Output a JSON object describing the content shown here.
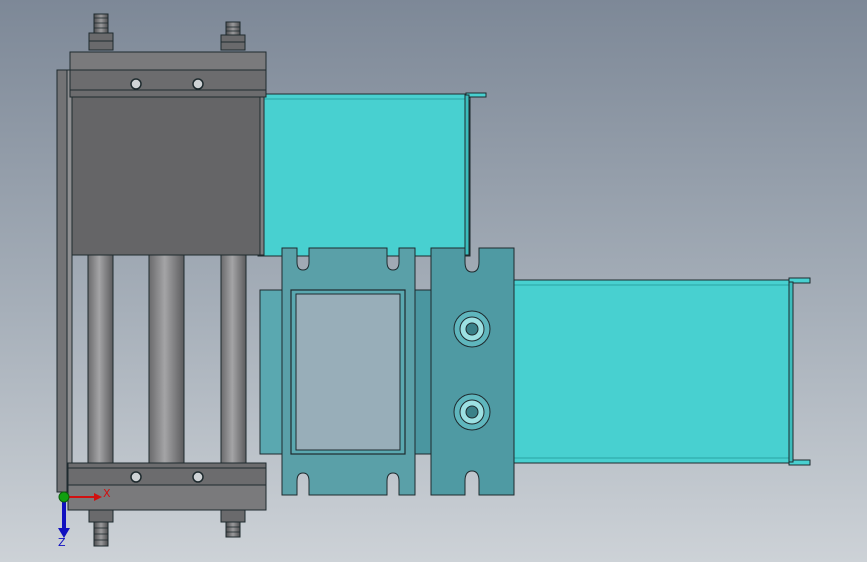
{
  "viewport": {
    "background_top": "#7d8897",
    "background_bottom": "#cdd2d7"
  },
  "colors": {
    "steel_dark": "#5f5f61",
    "steel_mid": "#737375",
    "steel_light": "#8e8e90",
    "rod": "#8a8a8c",
    "cyan_body": "#48d0d0",
    "cyan_edge": "#2aa4a4",
    "teal_plate": "#5aa8b0",
    "teal_plate_dark": "#4a96a0",
    "outline": "#1e2a2e",
    "axis_x": "#d01010",
    "axis_y": "#10a010",
    "axis_z": "#1010c0"
  },
  "triad": {
    "x_label": "X",
    "z_label": "Z"
  }
}
